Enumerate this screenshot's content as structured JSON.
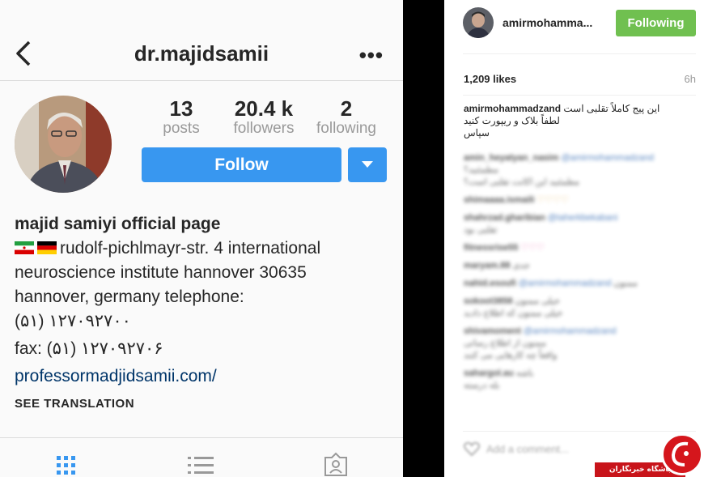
{
  "profile": {
    "username": "dr.majidsamii",
    "stats": [
      {
        "value": "13",
        "label": "posts"
      },
      {
        "value": "20.4 k",
        "label": "followers"
      },
      {
        "value": "2",
        "label": "following"
      }
    ],
    "follow_label": "Follow",
    "bio_name": "majid samiyi official page",
    "bio_line1": "rudolf-pichlmayr-str. 4 international",
    "bio_line2": "neuroscience institute hannover 30635",
    "bio_line3": "hannover, germany telephone:",
    "bio_line4": "(۵۱) ۱۲۷۰۹۲۷۰۰",
    "bio_line5": "fax: (۵۱) ۱۲۷۰۹۲۷۰۶",
    "bio_link": "professormadjidsamii.com/",
    "see_translation": "SEE TRANSLATION",
    "colors": {
      "accent": "#3897f0"
    }
  },
  "post": {
    "username": "amirmohamma...",
    "following_label": "Following",
    "likes": "1,209 likes",
    "time": "6h",
    "caption_user": "amirmohammadzand",
    "caption_line1": "این پیج کاملاً تقلبی است",
    "caption_line2": "لطفاً بلاک و ریپورت کنید",
    "caption_line3": "سپاس",
    "comments": [
      {
        "user": "amin_heyatyan_nasim",
        "mention": "@amirmohammadzand",
        "text": "مطمئنید؟"
      },
      {
        "user": "shimaaaa.ismaili",
        "mention": "",
        "text": "♡♡♡♡"
      },
      {
        "user": "shahrzad.gharibian",
        "mention": "@taherkbekabani",
        "text": "تقلبی بود"
      },
      {
        "user": "fitnessrise55",
        "mention": "",
        "text": "♡♡♡"
      },
      {
        "user": "maryam.88",
        "mention": "",
        "text": "جدی"
      },
      {
        "user": "nahid.esoufi",
        "mention": "@amirmohammadzand",
        "text": "ممنون"
      },
      {
        "user": "sokoot3858",
        "mention": "",
        "text": "خیلی ممنون"
      },
      {
        "user": "shivamoment",
        "mention": "@amirmohammadzand",
        "text": "ممنون از اطلاع رسانی"
      },
      {
        "user": "sahargol.au",
        "mention": "",
        "text": "باشه"
      }
    ],
    "add_comment": "Add a comment...",
    "colors": {
      "following": "#70c050"
    }
  },
  "watermark": {
    "text": "باشگاه خبرنگاران",
    "color": "#c8141a"
  }
}
